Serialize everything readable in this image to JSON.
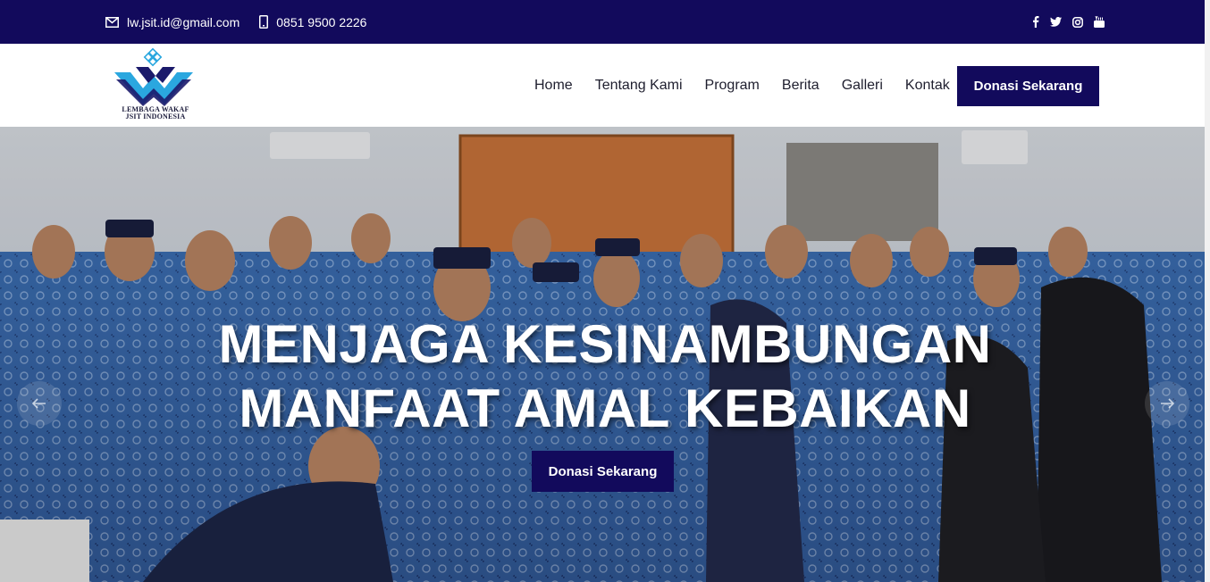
{
  "topbar": {
    "email": "lw.jsit.id@gmail.com",
    "phone": "0851 9500 2226",
    "email_icon": "envelope-icon",
    "phone_icon": "mobile-phone-icon",
    "social_icons": [
      "facebook-icon",
      "twitter-icon",
      "instagram-icon",
      "youtube-icon"
    ]
  },
  "header": {
    "logo_line1": "LEMBAGA WAKAF",
    "logo_line2": "JSIT INDONESIA",
    "nav": [
      "Home",
      "Tentang Kami",
      "Program",
      "Berita",
      "Galleri",
      "Kontak"
    ],
    "cta_label": "Donasi Sekarang"
  },
  "hero": {
    "title_line1": "MENJAGA KESINAMBUNGAN",
    "title_line2": "MANFAAT AMAL KEBAIKAN",
    "cta_label": "Donasi Sekarang",
    "prev_icon": "arrow-left-icon",
    "next_icon": "arrow-right-icon"
  },
  "colors": {
    "brand_navy": "#120a5c",
    "logo_blue": "#2aa7df",
    "logo_dark": "#1b1a6b"
  }
}
